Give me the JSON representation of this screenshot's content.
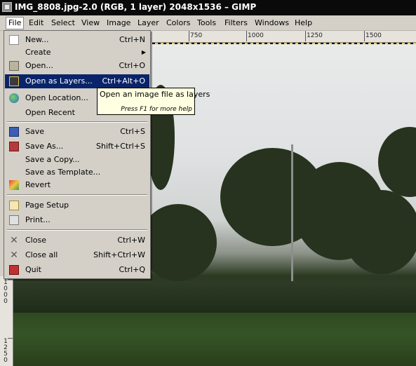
{
  "window": {
    "title": "IMG_8808.jpg-2.0 (RGB, 1 layer) 2048x1536 – GIMP"
  },
  "menubar": [
    "File",
    "Edit",
    "Select",
    "View",
    "Image",
    "Layer",
    "Colors",
    "Tools",
    "Filters",
    "Windows",
    "Help"
  ],
  "ruler": {
    "h_ticks": [
      "750",
      "1000",
      "1250",
      "1500"
    ],
    "v_ticks": [
      [
        "1",
        "0",
        "0",
        "0"
      ],
      [
        "1",
        "2",
        "5",
        "0"
      ]
    ]
  },
  "file_menu": {
    "items": [
      {
        "label": "New...",
        "accel": "Ctrl+N",
        "icon": "new-icon"
      },
      {
        "label": "Create",
        "accel": "",
        "icon": "",
        "submenu": true
      },
      {
        "label": "Open...",
        "accel": "Ctrl+O",
        "icon": "open-icon"
      },
      {
        "label": "Open as Layers...",
        "accel": "Ctrl+Alt+O",
        "icon": "layers-icon",
        "highlighted": true
      },
      {
        "label": "Open Location...",
        "accel": "",
        "icon": "globe-icon"
      },
      {
        "label": "Open Recent",
        "accel": "",
        "icon": ""
      },
      {
        "label": "Save",
        "accel": "Ctrl+S",
        "icon": "save-icon"
      },
      {
        "label": "Save As...",
        "accel": "Shift+Ctrl+S",
        "icon": "save-as-icon"
      },
      {
        "label": "Save a Copy...",
        "accel": "",
        "icon": ""
      },
      {
        "label": "Save as Template...",
        "accel": "",
        "icon": ""
      },
      {
        "label": "Revert",
        "accel": "",
        "icon": "revert-icon"
      },
      {
        "label": "Page Setup",
        "accel": "",
        "icon": "page-setup-icon"
      },
      {
        "label": "Print...",
        "accel": "",
        "icon": "print-icon"
      },
      {
        "label": "Close",
        "accel": "Ctrl+W",
        "icon": "close-icon"
      },
      {
        "label": "Close all",
        "accel": "Shift+Ctrl+W",
        "icon": "close-all-icon"
      },
      {
        "label": "Quit",
        "accel": "Ctrl+Q",
        "icon": "quit-icon"
      }
    ]
  },
  "tooltip": {
    "text": "Open an image file as layers",
    "hint": "Press F1 for more help"
  },
  "colors": {
    "highlight": "#0a246a",
    "menu_bg": "#d4d0c8",
    "tooltip_bg": "#ffffe1"
  }
}
